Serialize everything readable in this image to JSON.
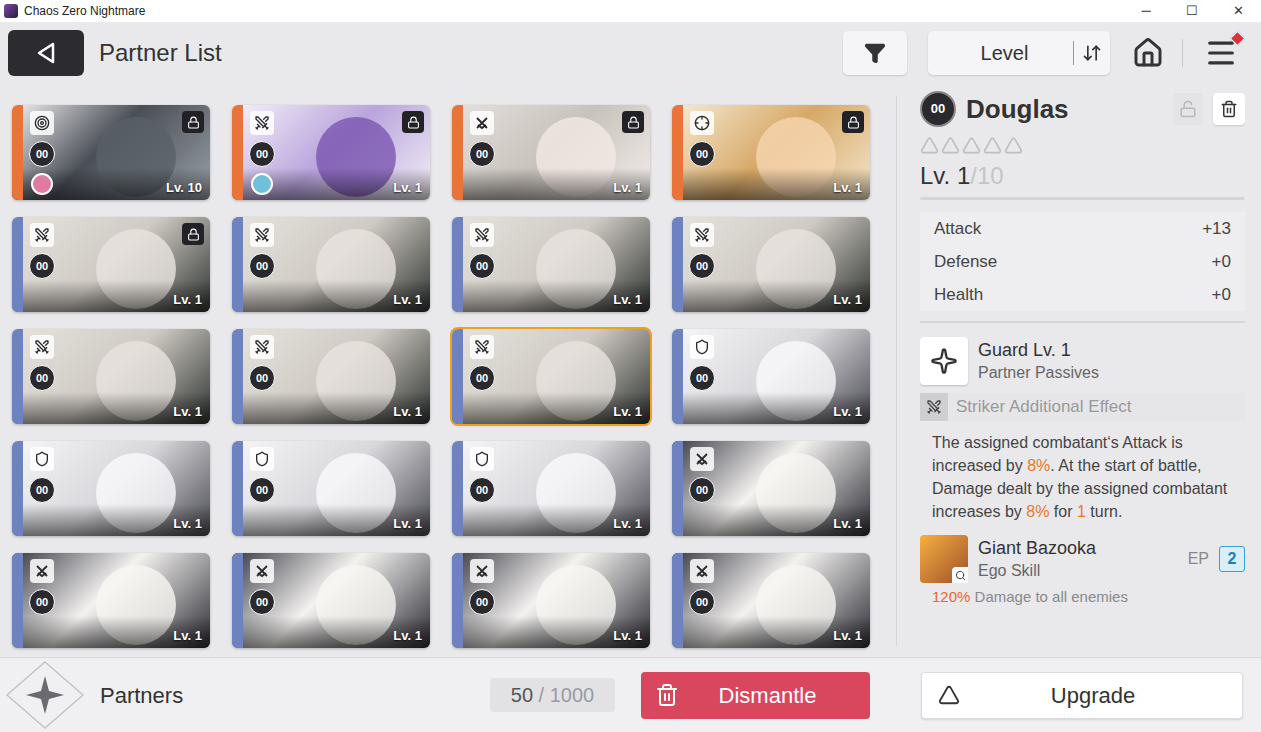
{
  "window": {
    "title": "Chaos Zero Nightmare",
    "controls": [
      "─",
      "☐",
      "✕"
    ]
  },
  "header": {
    "title": "Partner List",
    "sort": {
      "label": "Level"
    },
    "menu_notification": true
  },
  "cards": [
    {
      "portrait": "mech",
      "class": "controller",
      "badge": "00",
      "level": "Lv. 10",
      "locked": true,
      "selected": false,
      "color": "#e8743a",
      "avatar": "#e07aa0"
    },
    {
      "portrait": "witch",
      "class": "striker",
      "badge": "00",
      "level": "Lv. 1",
      "locked": true,
      "selected": false,
      "color": "#e8743a",
      "avatar": "#6fc0d8"
    },
    {
      "portrait": "silver",
      "class": "hunter",
      "badge": "00",
      "level": "Lv. 1",
      "locked": true,
      "selected": false,
      "color": "#e8743a",
      "avatar": null
    },
    {
      "portrait": "blonde",
      "class": "ranger",
      "badge": "00",
      "level": "Lv. 1",
      "locked": true,
      "selected": false,
      "color": "#e8743a",
      "avatar": null
    },
    {
      "portrait": "bird",
      "class": "striker",
      "badge": "00",
      "level": "Lv. 1",
      "locked": true,
      "selected": false,
      "color": "#6d82bf",
      "avatar": null
    },
    {
      "portrait": "bird",
      "class": "striker",
      "badge": "00",
      "level": "Lv. 1",
      "locked": false,
      "selected": false,
      "color": "#6d82bf",
      "avatar": null
    },
    {
      "portrait": "bird",
      "class": "striker",
      "badge": "00",
      "level": "Lv. 1",
      "locked": false,
      "selected": false,
      "color": "#6d82bf",
      "avatar": null
    },
    {
      "portrait": "bird",
      "class": "striker",
      "badge": "00",
      "level": "Lv. 1",
      "locked": false,
      "selected": false,
      "color": "#6d82bf",
      "avatar": null
    },
    {
      "portrait": "bird",
      "class": "striker",
      "badge": "00",
      "level": "Lv. 1",
      "locked": false,
      "selected": false,
      "color": "#6d82bf",
      "avatar": null
    },
    {
      "portrait": "bird",
      "class": "striker",
      "badge": "00",
      "level": "Lv. 1",
      "locked": false,
      "selected": false,
      "color": "#6d82bf",
      "avatar": null
    },
    {
      "portrait": "bird",
      "class": "striker",
      "badge": "00",
      "level": "Lv. 1",
      "locked": false,
      "selected": true,
      "color": "#6d82bf",
      "avatar": null
    },
    {
      "portrait": "phantom",
      "class": "vanguard",
      "badge": "00",
      "level": "Lv. 1",
      "locked": false,
      "selected": false,
      "color": "#6d82bf",
      "avatar": null
    },
    {
      "portrait": "phantom",
      "class": "vanguard",
      "badge": "00",
      "level": "Lv. 1",
      "locked": false,
      "selected": false,
      "color": "#6d82bf",
      "avatar": null
    },
    {
      "portrait": "phantom",
      "class": "vanguard",
      "badge": "00",
      "level": "Lv. 1",
      "locked": false,
      "selected": false,
      "color": "#6d82bf",
      "avatar": null
    },
    {
      "portrait": "phantom",
      "class": "vanguard",
      "badge": "00",
      "level": "Lv. 1",
      "locked": false,
      "selected": false,
      "color": "#6d82bf",
      "avatar": null
    },
    {
      "portrait": "bunny",
      "class": "hunter",
      "badge": "00",
      "level": "Lv. 1",
      "locked": false,
      "selected": false,
      "color": "#6d82bf",
      "avatar": null
    },
    {
      "portrait": "bunny",
      "class": "hunter",
      "badge": "00",
      "level": "Lv. 1",
      "locked": false,
      "selected": false,
      "color": "#6d82bf",
      "avatar": null
    },
    {
      "portrait": "bunny",
      "class": "hunter",
      "badge": "00",
      "level": "Lv. 1",
      "locked": false,
      "selected": false,
      "color": "#6d82bf",
      "avatar": null
    },
    {
      "portrait": "bunny",
      "class": "hunter",
      "badge": "00",
      "level": "Lv. 1",
      "locked": false,
      "selected": false,
      "color": "#6d82bf",
      "avatar": null
    },
    {
      "portrait": "bunny",
      "class": "hunter",
      "badge": "00",
      "level": "Lv. 1",
      "locked": false,
      "selected": false,
      "color": "#6d82bf",
      "avatar": null
    }
  ],
  "detail": {
    "badge": "00",
    "name": "Douglas",
    "locked": false,
    "stars": 0,
    "star_total": 5,
    "level": "Lv. 1",
    "max_level": "/10",
    "stats": [
      {
        "label": "Attack",
        "value": "+13"
      },
      {
        "label": "Defense",
        "value": "+0"
      },
      {
        "label": "Health",
        "value": "+0"
      }
    ],
    "passive": {
      "title": "Guard Lv. 1",
      "subtitle": "Partner Passives",
      "effect_label": "Striker Additional Effect",
      "description": [
        {
          "text": "The assigned combatant‘s Attack is increased by ",
          "highlight": false
        },
        {
          "text": "8%",
          "highlight": true
        },
        {
          "text": ". At the start of battle, Damage dealt by the assigned combatant increases by ",
          "highlight": false
        },
        {
          "text": "8%",
          "highlight": true
        },
        {
          "text": " for ",
          "highlight": false
        },
        {
          "text": "1",
          "highlight": true
        },
        {
          "text": " turn.",
          "highlight": false
        }
      ]
    },
    "ego": {
      "name": "Giant Bazooka",
      "type": "Ego Skill",
      "ep_label": "EP",
      "ep": "2",
      "description": [
        {
          "text": "120%",
          "highlight": true
        },
        {
          "text": " Damage to all enemies",
          "highlight": false
        }
      ]
    }
  },
  "footer": {
    "title": "Partners",
    "count": "50",
    "capacity": " / 1000",
    "dismantle": "Dismantle",
    "upgrade": "Upgrade"
  }
}
